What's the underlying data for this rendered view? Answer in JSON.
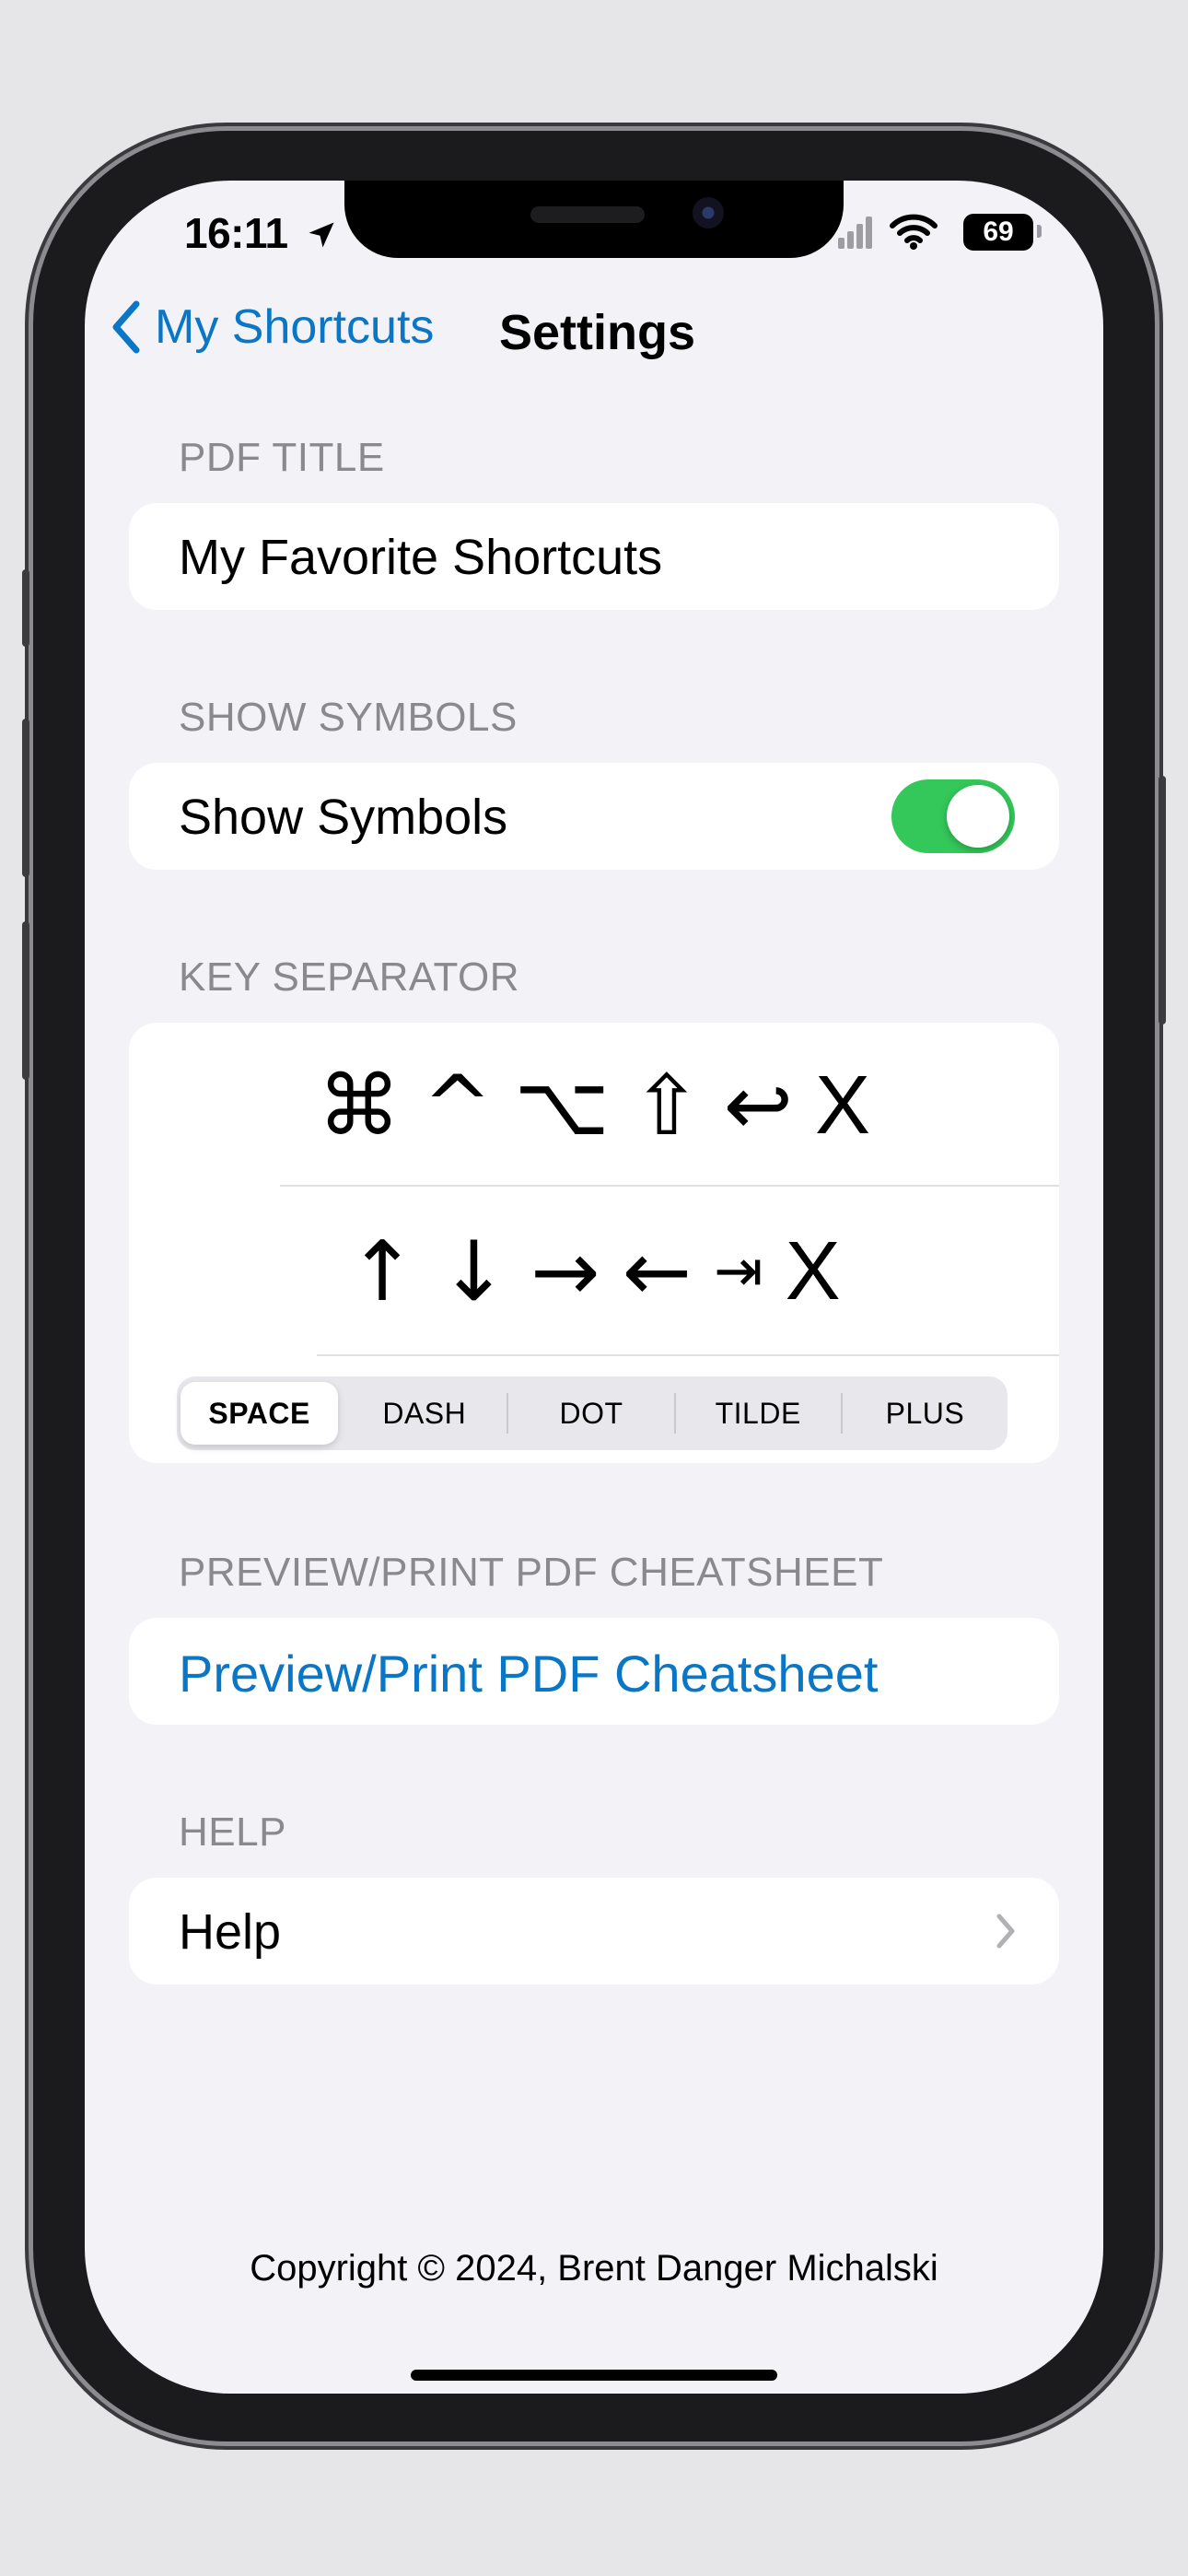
{
  "status_bar": {
    "time": "16:11",
    "battery": "69",
    "icons": [
      "location-arrow-icon",
      "cellular-signal-icon",
      "wifi-icon",
      "battery-icon"
    ]
  },
  "nav": {
    "back_label": "My Shortcuts",
    "title": "Settings"
  },
  "sections": {
    "pdf_title": {
      "header": "PDF TITLE",
      "value": "My Favorite Shortcuts"
    },
    "show_symbols": {
      "header": "SHOW SYMBOLS",
      "label": "Show Symbols",
      "toggle_on": true
    },
    "key_separator": {
      "header": "KEY SEPARATOR",
      "modifier_symbols": [
        "⌘",
        "^",
        "⌥",
        "⇧",
        "↩",
        "X"
      ],
      "arrow_symbols": [
        "↑",
        "↓",
        "→",
        "←",
        "⇥",
        "X"
      ],
      "options": [
        "SPACE",
        "DASH",
        "DOT",
        "TILDE",
        "PLUS"
      ],
      "selected": "SPACE"
    },
    "preview": {
      "header": "PREVIEW/PRINT PDF CHEATSHEET",
      "link": "Preview/Print PDF Cheatsheet"
    },
    "help": {
      "header": "HELP",
      "label": "Help"
    }
  },
  "footer": {
    "copyright": "Copyright © 2024, Brent Danger Michalski"
  },
  "colors": {
    "accent": "#0a76c6",
    "toggle_on": "#34c759",
    "background": "#f2f2f7"
  }
}
